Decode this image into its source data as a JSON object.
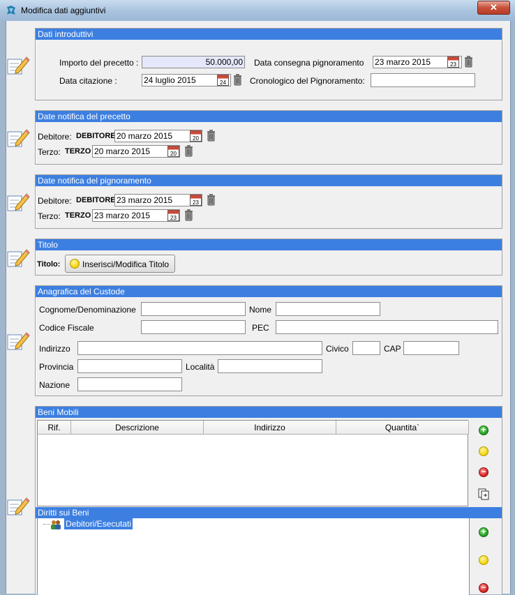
{
  "window": {
    "title": "Modifica dati aggiuntivi",
    "close_glyph": "✕",
    "icon": "app-logo-icon"
  },
  "dati_introduttivi": {
    "header": "Dati introduttivi",
    "importo_label": "Importo del precetto :",
    "importo_value": "50.000,00",
    "data_citazione_label": "Data citazione :",
    "data_citazione_value": "24 luglio 2015",
    "data_citazione_day": "24",
    "data_consegna_label": "Data consegna pignoramento",
    "data_consegna_value": "23 marzo 2015",
    "data_consegna_day": "23",
    "cronologico_label": "Cronologico del Pignoramento:",
    "cronologico_value": ""
  },
  "notifica_precetto": {
    "header": "Date notifica del precetto",
    "debitore_label": "Debitore:",
    "debitore_name": "DEBITORE",
    "debitore_date": "20 marzo 2015",
    "debitore_day": "20",
    "terzo_label": "Terzo:",
    "terzo_name": "TERZO",
    "terzo_date": "20 marzo 2015",
    "terzo_day": "20"
  },
  "notifica_pignoramento": {
    "header": "Date notifica del pignoramento",
    "debitore_label": "Debitore:",
    "debitore_name": "DEBITORE",
    "debitore_date": "23 marzo 2015",
    "debitore_day": "23",
    "terzo_label": "Terzo:",
    "terzo_name": "TERZO",
    "terzo_date": "23 marzo 2015",
    "terzo_day": "23"
  },
  "titolo": {
    "header": "Titolo",
    "label": "Titolo:",
    "button": "Inserisci/Modifica Titolo"
  },
  "custode": {
    "header": "Anagrafica del Custode",
    "cognome_label": "Cognome/Denominazione",
    "nome_label": "Nome",
    "cf_label": "Codice Fiscale",
    "pec_label": "PEC",
    "indirizzo_label": "Indirizzo",
    "civico_label": "Civico",
    "cap_label": "CAP",
    "provincia_label": "Provincia",
    "localita_label": "Località",
    "nazione_label": "Nazione"
  },
  "beni_mobili": {
    "header": "Beni Mobili",
    "columns": [
      "Rif.",
      "Descrizione",
      "Indirizzo",
      "Quantita`"
    ]
  },
  "diritti": {
    "header": "Diritti sui Beni",
    "tree_root": "Debitori/Esecutati"
  },
  "colors": {
    "group_header": "#3c7fe1",
    "window_bg": "#f0f0f0",
    "field_highlight": "#e5e8fb"
  }
}
